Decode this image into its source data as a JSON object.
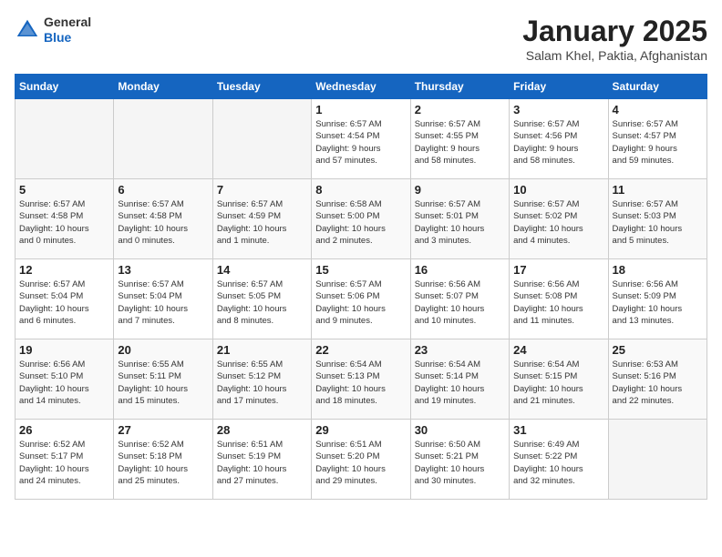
{
  "header": {
    "logo_general": "General",
    "logo_blue": "Blue",
    "month_title": "January 2025",
    "location": "Salam Khel, Paktia, Afghanistan"
  },
  "weekdays": [
    "Sunday",
    "Monday",
    "Tuesday",
    "Wednesday",
    "Thursday",
    "Friday",
    "Saturday"
  ],
  "weeks": [
    [
      {
        "day": "",
        "info": ""
      },
      {
        "day": "",
        "info": ""
      },
      {
        "day": "",
        "info": ""
      },
      {
        "day": "1",
        "info": "Sunrise: 6:57 AM\nSunset: 4:54 PM\nDaylight: 9 hours\nand 57 minutes."
      },
      {
        "day": "2",
        "info": "Sunrise: 6:57 AM\nSunset: 4:55 PM\nDaylight: 9 hours\nand 58 minutes."
      },
      {
        "day": "3",
        "info": "Sunrise: 6:57 AM\nSunset: 4:56 PM\nDaylight: 9 hours\nand 58 minutes."
      },
      {
        "day": "4",
        "info": "Sunrise: 6:57 AM\nSunset: 4:57 PM\nDaylight: 9 hours\nand 59 minutes."
      }
    ],
    [
      {
        "day": "5",
        "info": "Sunrise: 6:57 AM\nSunset: 4:58 PM\nDaylight: 10 hours\nand 0 minutes."
      },
      {
        "day": "6",
        "info": "Sunrise: 6:57 AM\nSunset: 4:58 PM\nDaylight: 10 hours\nand 0 minutes."
      },
      {
        "day": "7",
        "info": "Sunrise: 6:57 AM\nSunset: 4:59 PM\nDaylight: 10 hours\nand 1 minute."
      },
      {
        "day": "8",
        "info": "Sunrise: 6:58 AM\nSunset: 5:00 PM\nDaylight: 10 hours\nand 2 minutes."
      },
      {
        "day": "9",
        "info": "Sunrise: 6:57 AM\nSunset: 5:01 PM\nDaylight: 10 hours\nand 3 minutes."
      },
      {
        "day": "10",
        "info": "Sunrise: 6:57 AM\nSunset: 5:02 PM\nDaylight: 10 hours\nand 4 minutes."
      },
      {
        "day": "11",
        "info": "Sunrise: 6:57 AM\nSunset: 5:03 PM\nDaylight: 10 hours\nand 5 minutes."
      }
    ],
    [
      {
        "day": "12",
        "info": "Sunrise: 6:57 AM\nSunset: 5:04 PM\nDaylight: 10 hours\nand 6 minutes."
      },
      {
        "day": "13",
        "info": "Sunrise: 6:57 AM\nSunset: 5:04 PM\nDaylight: 10 hours\nand 7 minutes."
      },
      {
        "day": "14",
        "info": "Sunrise: 6:57 AM\nSunset: 5:05 PM\nDaylight: 10 hours\nand 8 minutes."
      },
      {
        "day": "15",
        "info": "Sunrise: 6:57 AM\nSunset: 5:06 PM\nDaylight: 10 hours\nand 9 minutes."
      },
      {
        "day": "16",
        "info": "Sunrise: 6:56 AM\nSunset: 5:07 PM\nDaylight: 10 hours\nand 10 minutes."
      },
      {
        "day": "17",
        "info": "Sunrise: 6:56 AM\nSunset: 5:08 PM\nDaylight: 10 hours\nand 11 minutes."
      },
      {
        "day": "18",
        "info": "Sunrise: 6:56 AM\nSunset: 5:09 PM\nDaylight: 10 hours\nand 13 minutes."
      }
    ],
    [
      {
        "day": "19",
        "info": "Sunrise: 6:56 AM\nSunset: 5:10 PM\nDaylight: 10 hours\nand 14 minutes."
      },
      {
        "day": "20",
        "info": "Sunrise: 6:55 AM\nSunset: 5:11 PM\nDaylight: 10 hours\nand 15 minutes."
      },
      {
        "day": "21",
        "info": "Sunrise: 6:55 AM\nSunset: 5:12 PM\nDaylight: 10 hours\nand 17 minutes."
      },
      {
        "day": "22",
        "info": "Sunrise: 6:54 AM\nSunset: 5:13 PM\nDaylight: 10 hours\nand 18 minutes."
      },
      {
        "day": "23",
        "info": "Sunrise: 6:54 AM\nSunset: 5:14 PM\nDaylight: 10 hours\nand 19 minutes."
      },
      {
        "day": "24",
        "info": "Sunrise: 6:54 AM\nSunset: 5:15 PM\nDaylight: 10 hours\nand 21 minutes."
      },
      {
        "day": "25",
        "info": "Sunrise: 6:53 AM\nSunset: 5:16 PM\nDaylight: 10 hours\nand 22 minutes."
      }
    ],
    [
      {
        "day": "26",
        "info": "Sunrise: 6:52 AM\nSunset: 5:17 PM\nDaylight: 10 hours\nand 24 minutes."
      },
      {
        "day": "27",
        "info": "Sunrise: 6:52 AM\nSunset: 5:18 PM\nDaylight: 10 hours\nand 25 minutes."
      },
      {
        "day": "28",
        "info": "Sunrise: 6:51 AM\nSunset: 5:19 PM\nDaylight: 10 hours\nand 27 minutes."
      },
      {
        "day": "29",
        "info": "Sunrise: 6:51 AM\nSunset: 5:20 PM\nDaylight: 10 hours\nand 29 minutes."
      },
      {
        "day": "30",
        "info": "Sunrise: 6:50 AM\nSunset: 5:21 PM\nDaylight: 10 hours\nand 30 minutes."
      },
      {
        "day": "31",
        "info": "Sunrise: 6:49 AM\nSunset: 5:22 PM\nDaylight: 10 hours\nand 32 minutes."
      },
      {
        "day": "",
        "info": ""
      }
    ]
  ]
}
